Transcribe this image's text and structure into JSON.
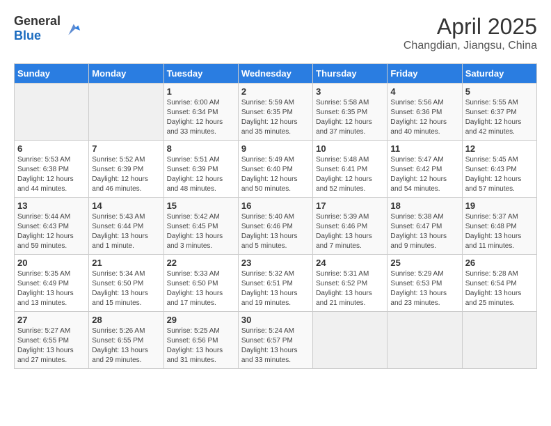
{
  "header": {
    "logo_general": "General",
    "logo_blue": "Blue",
    "month_title": "April 2025",
    "location": "Changdian, Jiangsu, China"
  },
  "weekdays": [
    "Sunday",
    "Monday",
    "Tuesday",
    "Wednesday",
    "Thursday",
    "Friday",
    "Saturday"
  ],
  "weeks": [
    [
      {
        "day": "",
        "sunrise": "",
        "sunset": "",
        "daylight": ""
      },
      {
        "day": "",
        "sunrise": "",
        "sunset": "",
        "daylight": ""
      },
      {
        "day": "1",
        "sunrise": "Sunrise: 6:00 AM",
        "sunset": "Sunset: 6:34 PM",
        "daylight": "Daylight: 12 hours and 33 minutes."
      },
      {
        "day": "2",
        "sunrise": "Sunrise: 5:59 AM",
        "sunset": "Sunset: 6:35 PM",
        "daylight": "Daylight: 12 hours and 35 minutes."
      },
      {
        "day": "3",
        "sunrise": "Sunrise: 5:58 AM",
        "sunset": "Sunset: 6:35 PM",
        "daylight": "Daylight: 12 hours and 37 minutes."
      },
      {
        "day": "4",
        "sunrise": "Sunrise: 5:56 AM",
        "sunset": "Sunset: 6:36 PM",
        "daylight": "Daylight: 12 hours and 40 minutes."
      },
      {
        "day": "5",
        "sunrise": "Sunrise: 5:55 AM",
        "sunset": "Sunset: 6:37 PM",
        "daylight": "Daylight: 12 hours and 42 minutes."
      }
    ],
    [
      {
        "day": "6",
        "sunrise": "Sunrise: 5:53 AM",
        "sunset": "Sunset: 6:38 PM",
        "daylight": "Daylight: 12 hours and 44 minutes."
      },
      {
        "day": "7",
        "sunrise": "Sunrise: 5:52 AM",
        "sunset": "Sunset: 6:39 PM",
        "daylight": "Daylight: 12 hours and 46 minutes."
      },
      {
        "day": "8",
        "sunrise": "Sunrise: 5:51 AM",
        "sunset": "Sunset: 6:39 PM",
        "daylight": "Daylight: 12 hours and 48 minutes."
      },
      {
        "day": "9",
        "sunrise": "Sunrise: 5:49 AM",
        "sunset": "Sunset: 6:40 PM",
        "daylight": "Daylight: 12 hours and 50 minutes."
      },
      {
        "day": "10",
        "sunrise": "Sunrise: 5:48 AM",
        "sunset": "Sunset: 6:41 PM",
        "daylight": "Daylight: 12 hours and 52 minutes."
      },
      {
        "day": "11",
        "sunrise": "Sunrise: 5:47 AM",
        "sunset": "Sunset: 6:42 PM",
        "daylight": "Daylight: 12 hours and 54 minutes."
      },
      {
        "day": "12",
        "sunrise": "Sunrise: 5:45 AM",
        "sunset": "Sunset: 6:43 PM",
        "daylight": "Daylight: 12 hours and 57 minutes."
      }
    ],
    [
      {
        "day": "13",
        "sunrise": "Sunrise: 5:44 AM",
        "sunset": "Sunset: 6:43 PM",
        "daylight": "Daylight: 12 hours and 59 minutes."
      },
      {
        "day": "14",
        "sunrise": "Sunrise: 5:43 AM",
        "sunset": "Sunset: 6:44 PM",
        "daylight": "Daylight: 13 hours and 1 minute."
      },
      {
        "day": "15",
        "sunrise": "Sunrise: 5:42 AM",
        "sunset": "Sunset: 6:45 PM",
        "daylight": "Daylight: 13 hours and 3 minutes."
      },
      {
        "day": "16",
        "sunrise": "Sunrise: 5:40 AM",
        "sunset": "Sunset: 6:46 PM",
        "daylight": "Daylight: 13 hours and 5 minutes."
      },
      {
        "day": "17",
        "sunrise": "Sunrise: 5:39 AM",
        "sunset": "Sunset: 6:46 PM",
        "daylight": "Daylight: 13 hours and 7 minutes."
      },
      {
        "day": "18",
        "sunrise": "Sunrise: 5:38 AM",
        "sunset": "Sunset: 6:47 PM",
        "daylight": "Daylight: 13 hours and 9 minutes."
      },
      {
        "day": "19",
        "sunrise": "Sunrise: 5:37 AM",
        "sunset": "Sunset: 6:48 PM",
        "daylight": "Daylight: 13 hours and 11 minutes."
      }
    ],
    [
      {
        "day": "20",
        "sunrise": "Sunrise: 5:35 AM",
        "sunset": "Sunset: 6:49 PM",
        "daylight": "Daylight: 13 hours and 13 minutes."
      },
      {
        "day": "21",
        "sunrise": "Sunrise: 5:34 AM",
        "sunset": "Sunset: 6:50 PM",
        "daylight": "Daylight: 13 hours and 15 minutes."
      },
      {
        "day": "22",
        "sunrise": "Sunrise: 5:33 AM",
        "sunset": "Sunset: 6:50 PM",
        "daylight": "Daylight: 13 hours and 17 minutes."
      },
      {
        "day": "23",
        "sunrise": "Sunrise: 5:32 AM",
        "sunset": "Sunset: 6:51 PM",
        "daylight": "Daylight: 13 hours and 19 minutes."
      },
      {
        "day": "24",
        "sunrise": "Sunrise: 5:31 AM",
        "sunset": "Sunset: 6:52 PM",
        "daylight": "Daylight: 13 hours and 21 minutes."
      },
      {
        "day": "25",
        "sunrise": "Sunrise: 5:29 AM",
        "sunset": "Sunset: 6:53 PM",
        "daylight": "Daylight: 13 hours and 23 minutes."
      },
      {
        "day": "26",
        "sunrise": "Sunrise: 5:28 AM",
        "sunset": "Sunset: 6:54 PM",
        "daylight": "Daylight: 13 hours and 25 minutes."
      }
    ],
    [
      {
        "day": "27",
        "sunrise": "Sunrise: 5:27 AM",
        "sunset": "Sunset: 6:55 PM",
        "daylight": "Daylight: 13 hours and 27 minutes."
      },
      {
        "day": "28",
        "sunrise": "Sunrise: 5:26 AM",
        "sunset": "Sunset: 6:55 PM",
        "daylight": "Daylight: 13 hours and 29 minutes."
      },
      {
        "day": "29",
        "sunrise": "Sunrise: 5:25 AM",
        "sunset": "Sunset: 6:56 PM",
        "daylight": "Daylight: 13 hours and 31 minutes."
      },
      {
        "day": "30",
        "sunrise": "Sunrise: 5:24 AM",
        "sunset": "Sunset: 6:57 PM",
        "daylight": "Daylight: 13 hours and 33 minutes."
      },
      {
        "day": "",
        "sunrise": "",
        "sunset": "",
        "daylight": ""
      },
      {
        "day": "",
        "sunrise": "",
        "sunset": "",
        "daylight": ""
      },
      {
        "day": "",
        "sunrise": "",
        "sunset": "",
        "daylight": ""
      }
    ]
  ]
}
